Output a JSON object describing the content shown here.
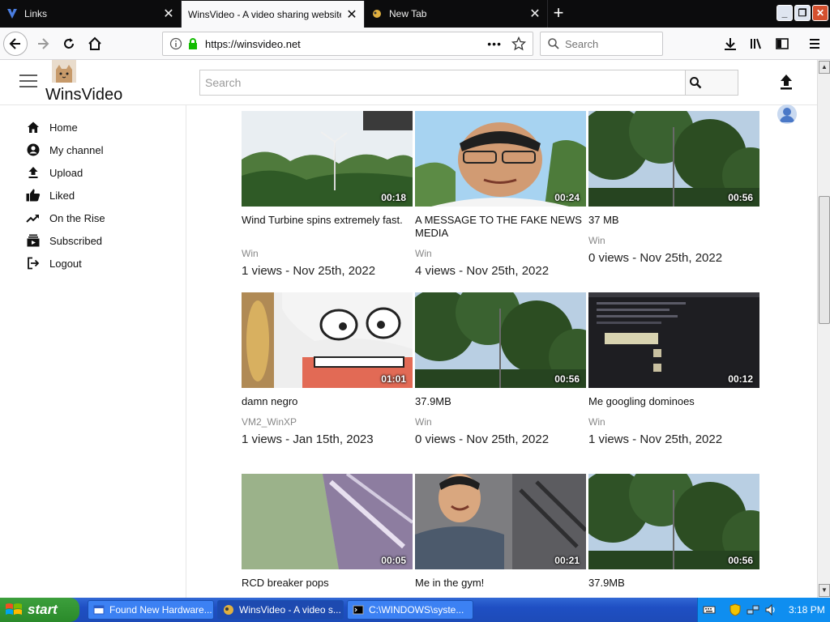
{
  "browser": {
    "tabs": [
      {
        "label": "Links",
        "active": false
      },
      {
        "label": "WinsVideo - A video sharing website fo",
        "active": true
      },
      {
        "label": "New Tab",
        "active": false
      }
    ],
    "url": "https://winsvideo.net",
    "search_placeholder": "Search"
  },
  "site": {
    "logo_text": "WinsVideo",
    "search_placeholder": "Search"
  },
  "sidebar": {
    "items": [
      {
        "label": "Home",
        "icon": "home-icon"
      },
      {
        "label": "My channel",
        "icon": "account-icon"
      },
      {
        "label": "Upload",
        "icon": "upload-icon"
      },
      {
        "label": "Liked",
        "icon": "thumb-up-icon"
      },
      {
        "label": "On the Rise",
        "icon": "trending-icon"
      },
      {
        "label": "Subscribed",
        "icon": "subscriptions-icon"
      },
      {
        "label": "Logout",
        "icon": "logout-icon"
      }
    ]
  },
  "videos": [
    {
      "duration": "00:18",
      "title": "Wind Turbine spins extremely fast.",
      "author": "Win",
      "meta": "1 views - Nov 25th, 2022"
    },
    {
      "duration": "00:24",
      "title": "A MESSAGE TO THE FAKE NEWS MEDIA",
      "author": "Win",
      "meta": "4 views - Nov 25th, 2022"
    },
    {
      "duration": "00:56",
      "title": "37 MB",
      "author": "Win",
      "meta": "0 views - Nov 25th, 2022"
    },
    {
      "duration": "01:01",
      "title": "damn negro",
      "author": "VM2_WinXP",
      "meta": "1 views - Jan 15th, 2023"
    },
    {
      "duration": "00:56",
      "title": "37.9MB",
      "author": "Win",
      "meta": "0 views - Nov 25th, 2022"
    },
    {
      "duration": "00:12",
      "title": "Me googling dominoes",
      "author": "Win",
      "meta": "1 views - Nov 25th, 2022"
    },
    {
      "duration": "00:05",
      "title": "RCD breaker pops",
      "author": "",
      "meta": ""
    },
    {
      "duration": "00:21",
      "title": "Me in the gym!",
      "author": "",
      "meta": ""
    },
    {
      "duration": "00:56",
      "title": "37.9MB",
      "author": "",
      "meta": ""
    }
  ],
  "taskbar": {
    "start_label": "start",
    "tasks": [
      {
        "label": "Found New Hardware...",
        "active": false
      },
      {
        "label": "WinsVideo - A video s...",
        "active": true
      },
      {
        "label": "C:\\WINDOWS\\syste...",
        "active": false
      }
    ],
    "clock": "3:18 PM"
  },
  "colors": {
    "accent_blue": "#1d4bb8",
    "start_green": "#2a8a2a",
    "tabbar_dark": "#0c0c0d"
  }
}
